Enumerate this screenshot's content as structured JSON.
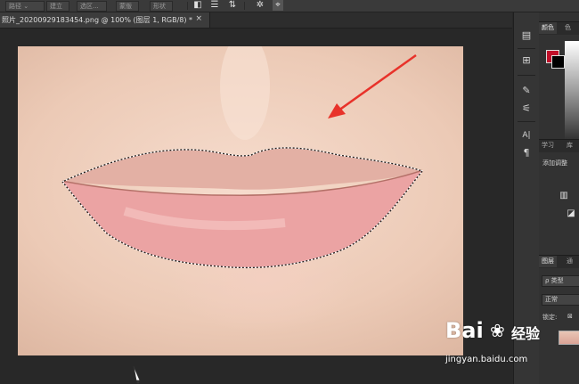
{
  "options_bar": {
    "mode_select": "路径",
    "mode_button_1": "建立",
    "mode_button_2": "选区...",
    "mode_button_3": "蒙版",
    "mode_button_4": "形状"
  },
  "document": {
    "tab_title": "照片_20200929183454.png @ 100% (图层 1, RGB/8) *",
    "close_glyph": "×"
  },
  "tool_strip": {
    "icons": [
      "history-icon",
      "properties-icon",
      "brush-icon",
      "adjust-icon",
      "character-icon",
      "paragraph-icon"
    ],
    "text_glyph": "A|",
    "para_glyph": "¶"
  },
  "panels": {
    "color_tab": "颜色",
    "swatches_tab": "色",
    "learn_tab": "学习",
    "library_tab": "库",
    "adjustments_label": "添加调整",
    "layers_tab": "图层",
    "channels_tab": "通",
    "filter_kind": "ρ 类型",
    "blend_mode": "正常",
    "lock_label": "锁定:",
    "fg_color": "#c0102a",
    "bg_color": "#000000"
  },
  "watermark": {
    "brand": "Bai",
    "brand2": "经验",
    "url": "jingyan.baidu.com"
  },
  "colors": {
    "annotation_arrow": "#e8322a"
  }
}
